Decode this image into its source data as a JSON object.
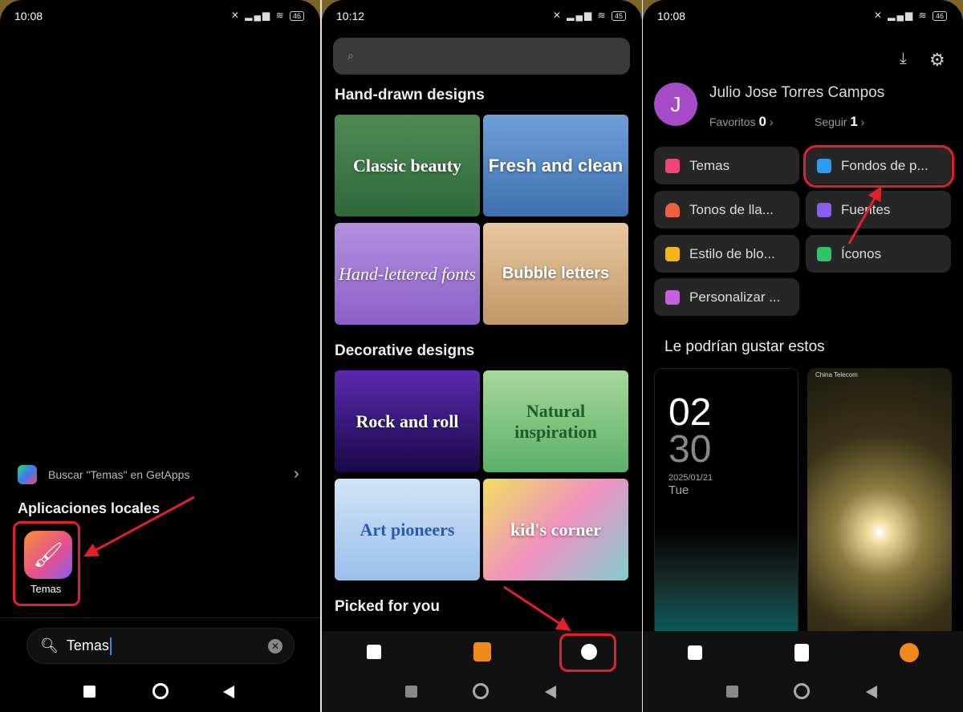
{
  "panel1": {
    "status": {
      "time": "10:08",
      "battery": "46"
    },
    "getapps_label": "Buscar \"Temas\" en GetApps",
    "section_title": "Aplicaciones locales",
    "app_label": "Temas",
    "search_value": "Temas"
  },
  "panel2": {
    "status": {
      "time": "10:12",
      "battery": "45"
    },
    "sections": [
      "Hand-drawn designs",
      "Decorative designs",
      "Picked for you"
    ],
    "tiles": [
      "Classic beauty",
      "Fresh and clean",
      "Hand-lettered fonts",
      "Bubble letters",
      "Rock and roll",
      "Natural inspiration",
      "Art pioneers",
      "kid's corner"
    ]
  },
  "panel3": {
    "status": {
      "time": "10:08",
      "battery": "46"
    },
    "avatar_letter": "J",
    "user_name": "Julio Jose Torres Campos",
    "favoritos_label": "Favoritos",
    "favoritos_count": "0",
    "seguir_label": "Seguir",
    "seguir_count": "1",
    "menu": [
      {
        "label": "Temas",
        "color": "#f0457a"
      },
      {
        "label": "Fondos de p...",
        "color": "#2e9bf0"
      },
      {
        "label": "Tonos de lla...",
        "color": "#f0603a"
      },
      {
        "label": "Fuentes",
        "color": "#8b5cf0"
      },
      {
        "label": "Estilo de blo...",
        "color": "#f5b51a"
      },
      {
        "label": "Íconos",
        "color": "#2fc46a"
      },
      {
        "label": "Personalizar ...",
        "color": "#c660e0"
      }
    ],
    "suggest_title": "Le podrían gustar estos",
    "preview1": {
      "hour": "02",
      "minute": "30",
      "date": "2025/01/21",
      "day": "Tue"
    },
    "preview2": {
      "carrier": "China Telecom"
    }
  },
  "colors": {
    "highlight": "#e3202a",
    "accent": "#f08a1c"
  }
}
